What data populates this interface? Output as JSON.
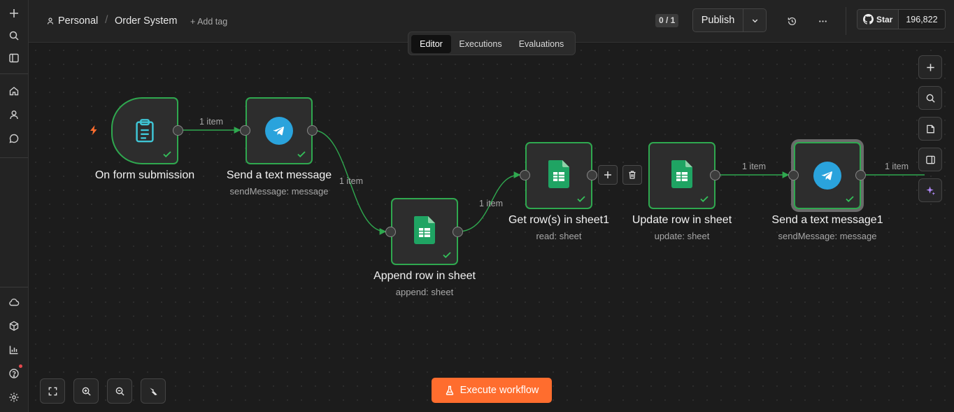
{
  "header": {
    "project": "Personal",
    "workflow_name": "Order System",
    "add_tag": "+ Add tag",
    "counter": "0 / 1",
    "publish_label": "Publish",
    "github_star_label": "Star",
    "github_star_count": "196,822"
  },
  "tabs": [
    {
      "label": "Editor",
      "active": true
    },
    {
      "label": "Executions",
      "active": false
    },
    {
      "label": "Evaluations",
      "active": false
    }
  ],
  "nodes": [
    {
      "label": "On form submission",
      "sub": "",
      "icon": "clipboard-icon"
    },
    {
      "label": "Send a text message",
      "sub": "sendMessage: message",
      "icon": "telegram-icon"
    },
    {
      "label": "Append row in sheet",
      "sub": "append: sheet",
      "icon": "google-sheets-icon"
    },
    {
      "label": "Get row(s) in sheet1",
      "sub": "read: sheet",
      "icon": "google-sheets-icon"
    },
    {
      "label": "Update row in sheet",
      "sub": "update: sheet",
      "icon": "google-sheets-icon"
    },
    {
      "label": "Send a text message1",
      "sub": "sendMessage: message",
      "icon": "telegram-icon"
    }
  ],
  "edges": [
    {
      "label": "1 item"
    },
    {
      "label": "1 item"
    },
    {
      "label": "1 item"
    },
    {
      "label": "1 item"
    },
    {
      "label": "1 item"
    }
  ],
  "execute_button": "Execute workflow",
  "colors": {
    "accent": "#ff6d2e",
    "success": "#2fa84f",
    "telegram": "#2aa3dc",
    "sheets": "#1fa463"
  }
}
